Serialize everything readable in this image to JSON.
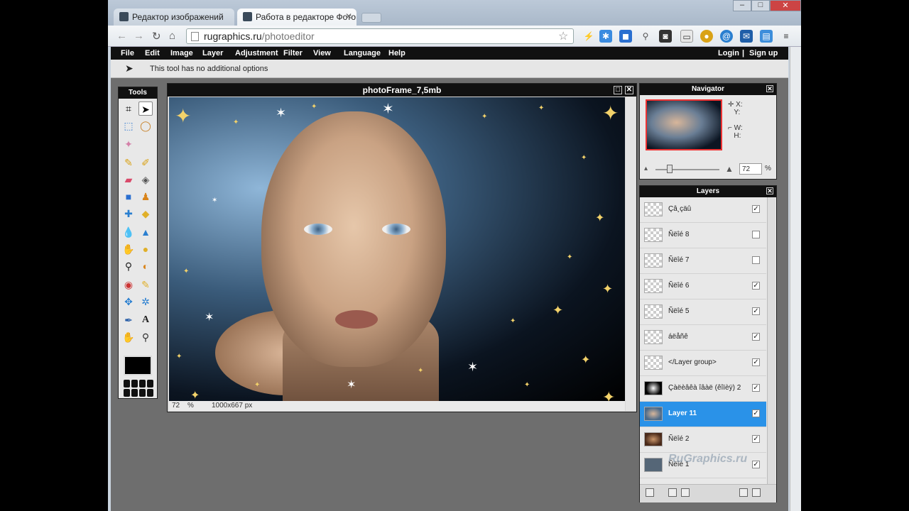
{
  "browser": {
    "tabs": [
      {
        "label": "Редактор изображений",
        "active": false
      },
      {
        "label": "Работа в редакторе Фото",
        "active": true
      }
    ],
    "url_domain": "rugraphics.ru",
    "url_path": "/photoeditor"
  },
  "menu": [
    "File",
    "Edit",
    "Image",
    "Layer",
    "Adjustment",
    "Filter",
    "View",
    "Language",
    "Help"
  ],
  "account": {
    "login": "Login",
    "separator": "|",
    "signup": "Sign up"
  },
  "options_bar": {
    "text": "This tool has no additional options"
  },
  "toolbox": {
    "title": "Tools"
  },
  "image_window": {
    "title": "photoFrame_7,5mb",
    "zoom": "72",
    "zoom_unit": "%",
    "dimensions": "1000x667 px"
  },
  "navigator": {
    "title": "Navigator",
    "x_label": "X:",
    "y_label": "Y:",
    "w_label": "W:",
    "h_label": "H:",
    "zoom_value": "72",
    "zoom_unit": "%"
  },
  "layers": {
    "title": "Layers",
    "items": [
      {
        "name": "Çâ¸çäû",
        "visible": true,
        "active": false
      },
      {
        "name": "Ñëîé 8",
        "visible": false,
        "active": false
      },
      {
        "name": "Ñëîé 7",
        "visible": false,
        "active": false
      },
      {
        "name": "Ñëîé 6",
        "visible": true,
        "active": false
      },
      {
        "name": "Ñëîé 5",
        "visible": true,
        "active": false
      },
      {
        "name": "áëåñê",
        "visible": true,
        "active": false
      },
      {
        "name": "</Layer group>",
        "visible": true,
        "active": false
      },
      {
        "name": "Çàëèâêà îâàë (êîïèÿ) 2",
        "visible": true,
        "active": false
      },
      {
        "name": "Layer 11",
        "visible": true,
        "active": true
      },
      {
        "name": "Ñëîé 2",
        "visible": true,
        "active": false
      },
      {
        "name": "Ñëîé 1",
        "visible": true,
        "active": false
      }
    ]
  },
  "watermark": "RuGraphics.ru"
}
